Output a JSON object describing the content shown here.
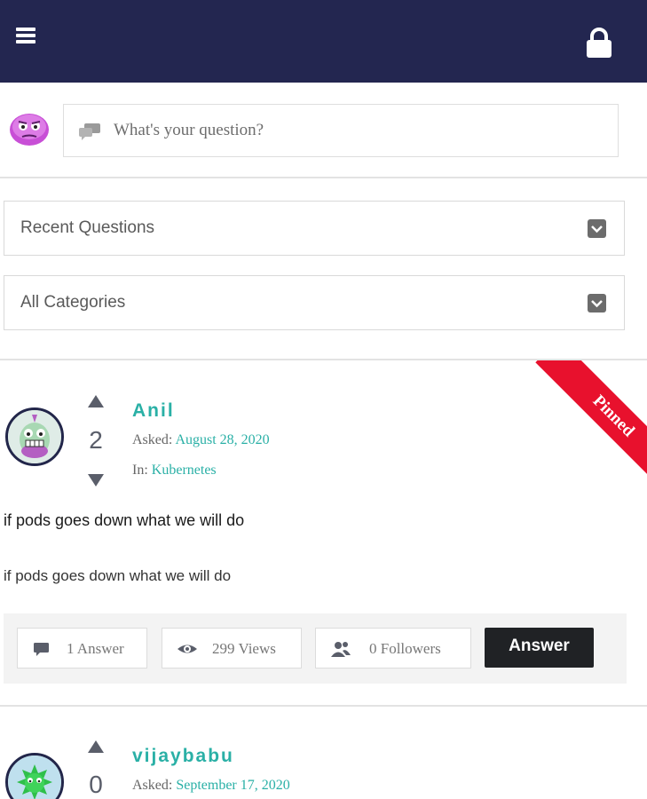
{
  "header": {
    "menu_icon": "hamburger-menu-icon",
    "lock_icon": "lock-icon",
    "background": "#232650"
  },
  "ask": {
    "avatar_icon": "purple-monster-avatar",
    "chat_icon": "chat-bubbles-icon",
    "placeholder": "What's your question?"
  },
  "filters": {
    "sort_selected": "Recent Questions",
    "category_selected": "All Categories"
  },
  "questions": [
    {
      "author": "Anil",
      "votes": "2",
      "asked_label": "Asked:",
      "asked_date": "August 28, 2020",
      "in_label": "In:",
      "category": "Kubernetes",
      "pinned_label": "Pinned",
      "title": "if pods goes down what we will do",
      "body": "if pods goes down what we will do",
      "answers": "1 Answer",
      "views": "299 Views",
      "followers": "0 Followers",
      "answer_button": "Answer"
    },
    {
      "author": "vijaybabu",
      "votes": "0",
      "asked_label": "Asked:",
      "asked_date": "September 17, 2020"
    }
  ],
  "colors": {
    "accent": "#2ab0a6",
    "pinned": "#e8112d",
    "answer_button": "#202225"
  }
}
